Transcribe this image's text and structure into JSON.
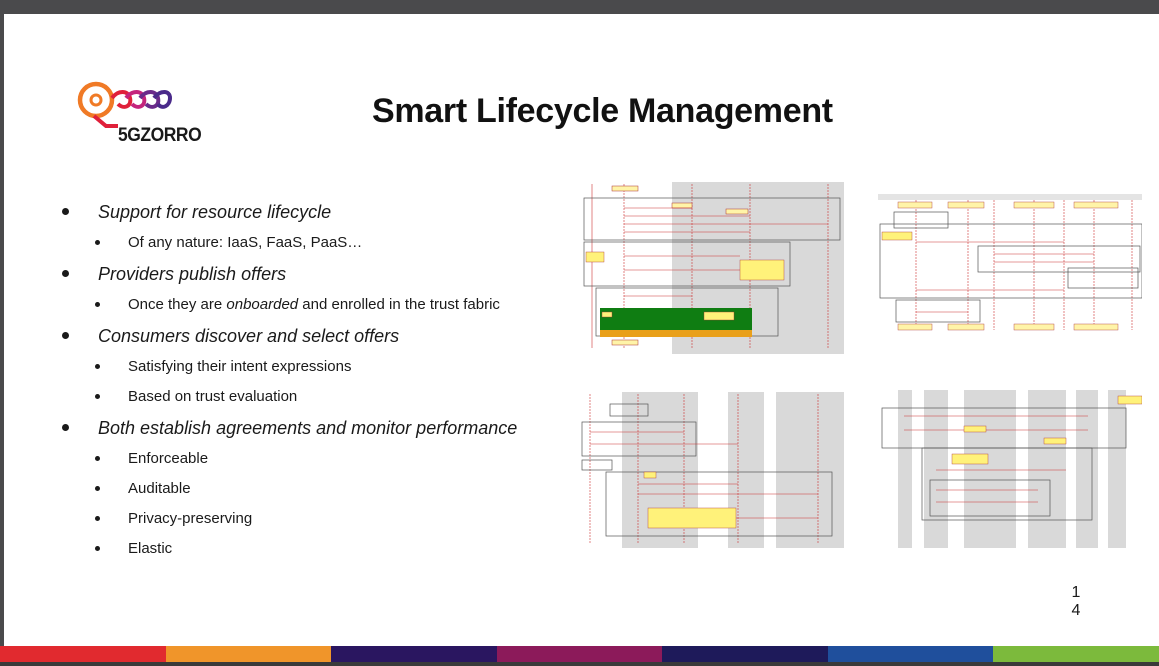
{
  "slide": {
    "title": "Smart Lifecycle Management",
    "logo_text": "5GZORRO",
    "page_number_line1": "1",
    "page_number_line2": "4"
  },
  "bullets": [
    {
      "text": "Support for resource lifecycle",
      "level": 1
    },
    {
      "text": "Of any nature: IaaS, FaaS, PaaS…",
      "level": 2
    },
    {
      "text": "Providers publish offers",
      "level": 1
    },
    {
      "text_before": "Once they are ",
      "text_emph": "onboarded",
      "text_after": " and enrolled in the trust fabric",
      "level": 2
    },
    {
      "text": "Consumers discover and select offers",
      "level": 1
    },
    {
      "text": "Satisfying their intent expressions",
      "level": 2
    },
    {
      "text": "Based on trust evaluation",
      "level": 2
    },
    {
      "text": "Both establish agreements and monitor performance",
      "level": 1
    },
    {
      "text": "Enforceable",
      "level": 2
    },
    {
      "text": "Auditable",
      "level": 2
    },
    {
      "text": "Privacy-preserving",
      "level": 2
    },
    {
      "text": "Elastic",
      "level": 2
    }
  ],
  "colors": {
    "logo_orange": "#f07a26",
    "logo_red": "#e0203a",
    "logo_purple": "#6a2a8a",
    "diagram_yellow": "#fff27a",
    "diagram_green": "#0f7d12",
    "diagram_orange": "#e9a01a",
    "bottom_bar": [
      "#e12a2f",
      "#f0952a",
      "#2a1660",
      "#8c1a5a",
      "#1e1a5a",
      "#1f4f9c",
      "#7cba3c"
    ]
  },
  "icons": [
    "5gzorro-logo-icon"
  ]
}
